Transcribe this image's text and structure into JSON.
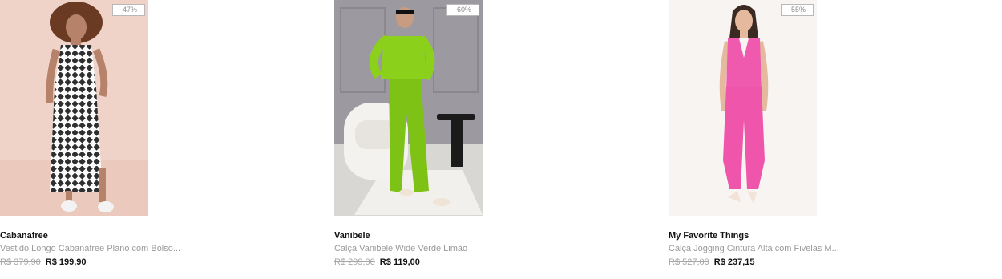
{
  "products": [
    {
      "discount_badge": "-47%",
      "brand": "Cabanafree",
      "description": "Vestido Longo Cabanafree Plano com Bolso...",
      "old_price": "R$ 379,90",
      "price": "R$ 199,90"
    },
    {
      "discount_badge": "-60%",
      "brand": "Vanibele",
      "description": "Calça Vanibele Wide Verde Limão",
      "old_price": "R$ 299,00",
      "price": "R$ 119,00"
    },
    {
      "discount_badge": "-55%",
      "brand": "My Favorite Things",
      "description": "Calça Jogging Cintura Alta com Fivelas M...",
      "old_price": "R$ 527,00",
      "price": "R$ 237,15"
    }
  ],
  "colors": {
    "photo1_background": "#f0d3c8",
    "photo2_background": "#9c9aa0",
    "photo3_background": "#f7f4f1",
    "dress_pattern": "#3a3a3a",
    "lime_outfit": "#8bd11c",
    "pink_outfit": "#f05aae"
  }
}
